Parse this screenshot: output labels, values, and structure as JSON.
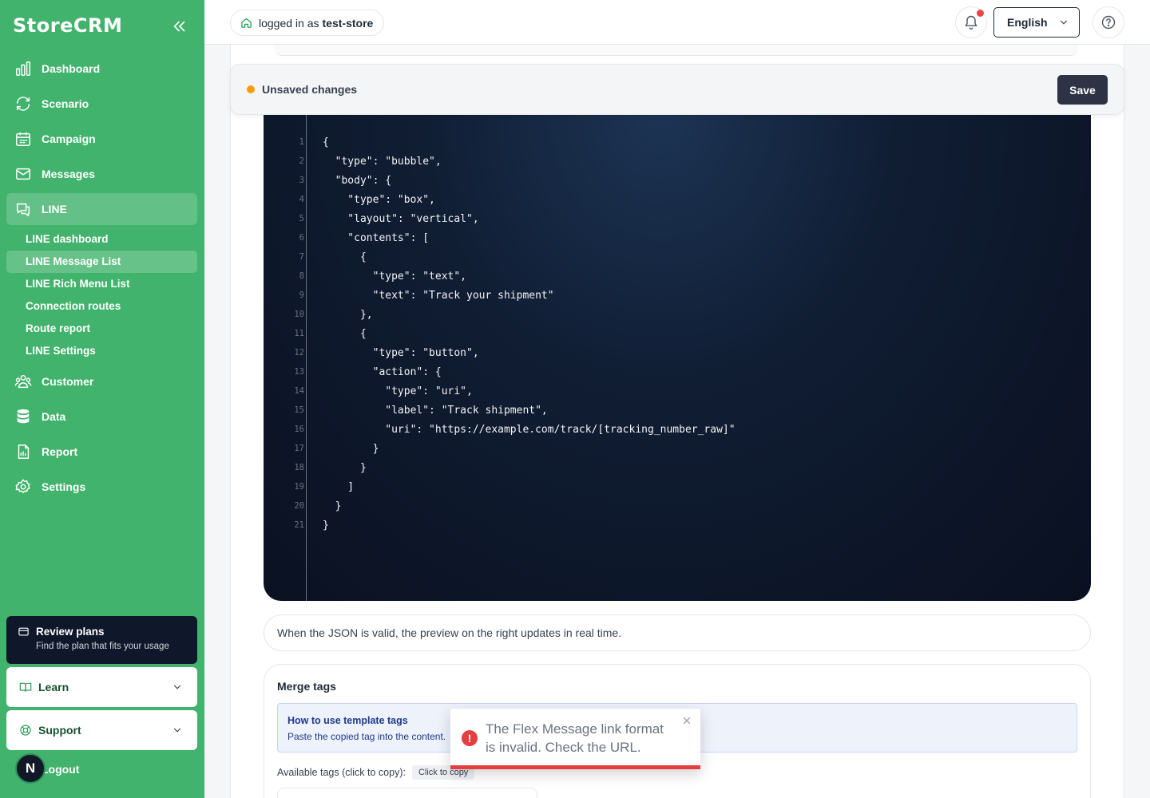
{
  "sidebar": {
    "brand": "StoreCRM",
    "nav": [
      {
        "label": "Dashboard",
        "icon": "bar-chart-icon"
      },
      {
        "label": "Scenario",
        "icon": "refresh-icon"
      },
      {
        "label": "Campaign",
        "icon": "calendar-icon"
      },
      {
        "label": "Messages",
        "icon": "mail-icon"
      },
      {
        "label": "LINE",
        "icon": "chat-icon"
      }
    ],
    "line_sub": [
      {
        "label": "LINE dashboard"
      },
      {
        "label": "LINE Message List"
      },
      {
        "label": "LINE Rich Menu List"
      },
      {
        "label": "Connection routes"
      },
      {
        "label": "Route report"
      },
      {
        "label": "LINE Settings"
      }
    ],
    "nav2": [
      {
        "label": "Customer",
        "icon": "users-icon"
      },
      {
        "label": "Data",
        "icon": "database-icon"
      },
      {
        "label": "Report",
        "icon": "report-icon"
      },
      {
        "label": "Settings",
        "icon": "gear-icon"
      }
    ],
    "review": {
      "title": "Review plans",
      "subtitle": "Find the plan that fits your usage"
    },
    "learn": "Learn",
    "support": "Support",
    "logout": "Logout",
    "avatar_letter": "N"
  },
  "topbar": {
    "logged_prefix": "logged in as",
    "user": "test-store",
    "language": "English"
  },
  "unsaved": {
    "text": "Unsaved changes",
    "save": "Save"
  },
  "editor": {
    "lines": [
      "{",
      "  \"type\": \"bubble\",",
      "  \"body\": {",
      "    \"type\": \"box\",",
      "    \"layout\": \"vertical\",",
      "    \"contents\": [",
      "      {",
      "        \"type\": \"text\",",
      "        \"text\": \"Track your shipment\"",
      "      },",
      "      {",
      "        \"type\": \"button\",",
      "        \"action\": {",
      "          \"type\": \"uri\",",
      "          \"label\": \"Track shipment\",",
      "          \"uri\": \"https://example.com/track/[tracking_number_raw]\"",
      "        }",
      "      }",
      "    ]",
      "  }",
      "}"
    ]
  },
  "hint": "When the JSON is valid, the preview on the right updates in real time.",
  "merge": {
    "title": "Merge tags",
    "info_title": "How to use template tags",
    "info_text": "Paste the copied tag into the content.",
    "available_label": "Available tags (click to copy):",
    "chip": "Click to copy"
  },
  "toast": {
    "message": "The Flex Message link format is invalid. Check the URL.",
    "progress": 1.0,
    "color": "#e53e3e"
  },
  "colors": {
    "sidebar": "#41b36c",
    "save": "#2d3344",
    "warning_dot": "#f59e0b"
  }
}
